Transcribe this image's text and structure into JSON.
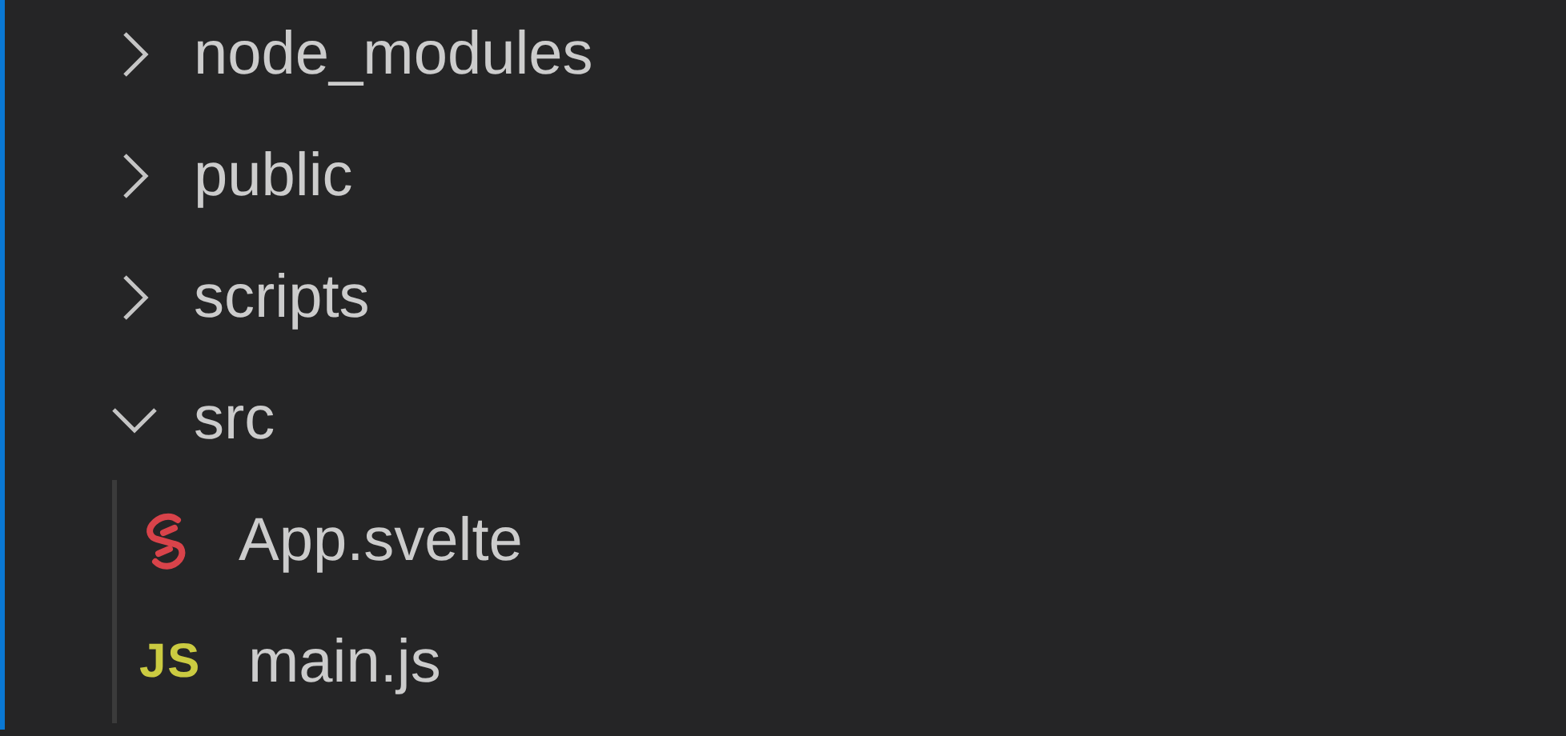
{
  "explorer": {
    "items": [
      {
        "kind": "folder",
        "label": "node_modules",
        "expanded": false
      },
      {
        "kind": "folder",
        "label": "public",
        "expanded": false
      },
      {
        "kind": "folder",
        "label": "scripts",
        "expanded": false
      },
      {
        "kind": "folder",
        "label": "src",
        "expanded": true,
        "children": [
          {
            "kind": "svelte",
            "label": "App.svelte"
          },
          {
            "kind": "js",
            "label": "main.js",
            "badge": "JS"
          }
        ]
      }
    ]
  }
}
